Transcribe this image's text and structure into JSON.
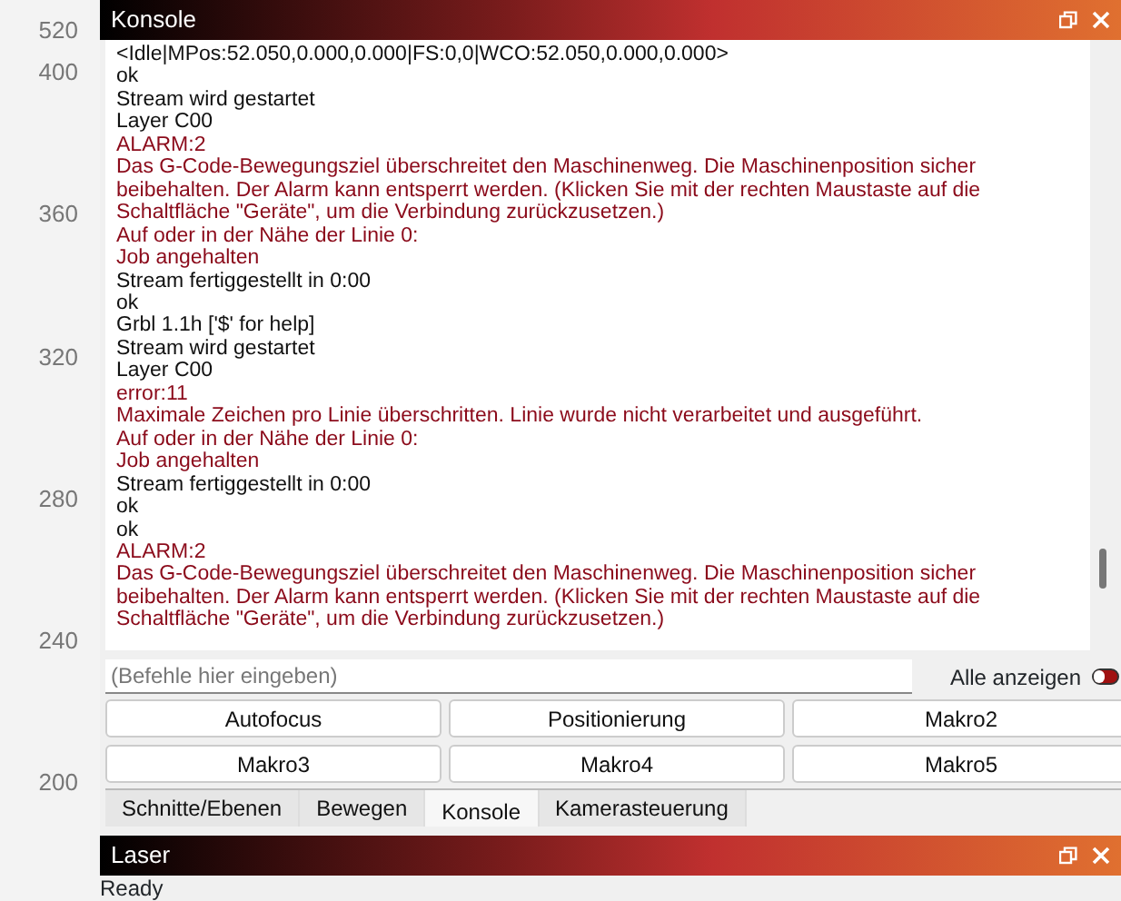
{
  "ruler_labels": [
    "520",
    "400",
    "360",
    "320",
    "280",
    "240",
    "200"
  ],
  "console_panel": {
    "title": "Konsole",
    "log": [
      {
        "kind": "normal",
        "text": "<Idle|MPos:52.050,0.000,0.000|FS:0,0|WCO:52.050,0.000,0.000>"
      },
      {
        "kind": "normal",
        "text": "ok"
      },
      {
        "kind": "normal",
        "text": "Stream wird gestartet"
      },
      {
        "kind": "normal",
        "text": "Layer C00"
      },
      {
        "kind": "alarm",
        "text": "ALARM:2"
      },
      {
        "kind": "alarm",
        "text": "Das G-Code-Bewegungsziel überschreitet den Maschinenweg. Die Maschinenposition sicher beibehalten. Der Alarm kann entsperrt werden. (Klicken Sie mit der rechten Maustaste auf die Schaltfläche \"Geräte\", um die Verbindung zurückzusetzen.)"
      },
      {
        "kind": "alarm",
        "text": "Auf oder in der Nähe der Linie 0:"
      },
      {
        "kind": "alarm",
        "text": "Job angehalten"
      },
      {
        "kind": "normal",
        "text": "Stream fertiggestellt in 0:00"
      },
      {
        "kind": "normal",
        "text": "ok"
      },
      {
        "kind": "normal",
        "text": "Grbl 1.1h ['$' for help]"
      },
      {
        "kind": "normal",
        "text": "Stream wird gestartet"
      },
      {
        "kind": "normal",
        "text": "Layer C00"
      },
      {
        "kind": "alarm",
        "text": "error:11"
      },
      {
        "kind": "alarm",
        "text": "Maximale Zeichen pro Linie überschritten. Linie wurde nicht verarbeitet und ausgeführt."
      },
      {
        "kind": "alarm",
        "text": "Auf oder in der Nähe der Linie 0:"
      },
      {
        "kind": "alarm",
        "text": "Job angehalten"
      },
      {
        "kind": "normal",
        "text": "Stream fertiggestellt in 0:00"
      },
      {
        "kind": "normal",
        "text": "ok"
      },
      {
        "kind": "normal",
        "text": "ok"
      },
      {
        "kind": "alarm",
        "text": "ALARM:2"
      },
      {
        "kind": "alarm",
        "text": "Das G-Code-Bewegungsziel überschreitet den Maschinenweg. Die Maschinenposition sicher beibehalten. Der Alarm kann entsperrt werden. (Klicken Sie mit der rechten Maustaste auf die Schaltfläche \"Geräte\", um die Verbindung zurückzusetzen.)"
      }
    ],
    "command_input": {
      "placeholder": "(Befehle hier eingeben)"
    },
    "show_all": {
      "label": "Alle anzeigen",
      "on": false
    },
    "macro_buttons": [
      "Autofocus",
      "Positionierung",
      "Makro2",
      "Makro3",
      "Makro4",
      "Makro5"
    ],
    "tabs": [
      {
        "label": "Schnitte/Ebenen",
        "selected": false
      },
      {
        "label": "Bewegen",
        "selected": false
      },
      {
        "label": "Konsole",
        "selected": true
      },
      {
        "label": "Kamerasteuerung",
        "selected": false
      }
    ]
  },
  "laser_panel": {
    "title": "Laser",
    "status": "Ready"
  }
}
